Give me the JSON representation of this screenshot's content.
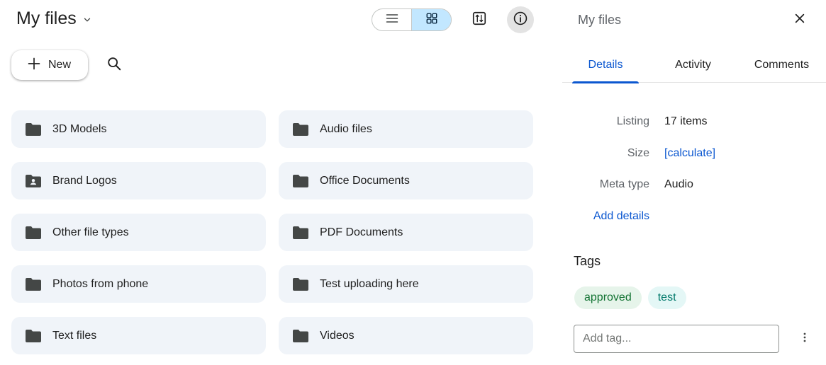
{
  "header": {
    "title": "My files",
    "title_icon": "chevron-down-icon",
    "view_list_icon": "list-view-icon",
    "view_grid_icon": "grid-view-icon",
    "sort_icon": "sort-options-icon",
    "info_icon": "info-icon"
  },
  "toolbar": {
    "new_label": "New",
    "new_icon": "plus-icon",
    "search_icon": "search-icon"
  },
  "folders": [
    {
      "name": "3D Models",
      "icon": "folder-icon"
    },
    {
      "name": "Audio files",
      "icon": "folder-icon"
    },
    {
      "name": "Brand Logos",
      "icon": "shared-folder-icon"
    },
    {
      "name": "Office Documents",
      "icon": "folder-icon"
    },
    {
      "name": "Other file types",
      "icon": "folder-icon"
    },
    {
      "name": "PDF Documents",
      "icon": "folder-icon"
    },
    {
      "name": "Photos from phone",
      "icon": "folder-icon"
    },
    {
      "name": "Test uploading here",
      "icon": "folder-icon"
    },
    {
      "name": "Text files",
      "icon": "folder-icon"
    },
    {
      "name": "Videos",
      "icon": "folder-icon"
    }
  ],
  "panel": {
    "title": "My files",
    "close_icon": "close-icon",
    "tabs": [
      "Details",
      "Activity",
      "Comments"
    ],
    "active_tab": "Details",
    "details": {
      "listing_label": "Listing",
      "listing_value": "17 items",
      "size_label": "Size",
      "size_value": "[calculate]",
      "meta_label": "Meta type",
      "meta_value": "Audio",
      "add_details": "Add details"
    },
    "tags_heading": "Tags",
    "tags": [
      "approved",
      "test"
    ],
    "tag_input_placeholder": "Add tag...",
    "more_icon": "more-vert-icon"
  },
  "colors": {
    "accent": "#0b57d0",
    "folder_bg": "#f0f4f9",
    "toggle_active": "#c2e7ff",
    "tag_approved_bg": "#e6f4ea",
    "tag_approved_fg": "#137333",
    "tag_test_bg": "#e4f7f6",
    "tag_test_fg": "#00796b"
  }
}
